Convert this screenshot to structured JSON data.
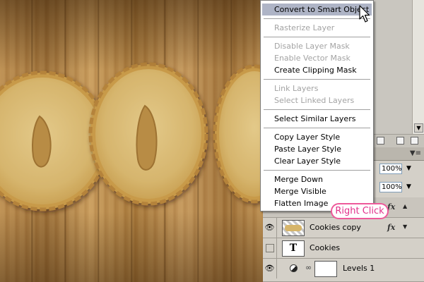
{
  "context_menu": {
    "items": [
      {
        "label": "Convert to Smart Object",
        "state": "highlighted"
      },
      {
        "label": "Rasterize Layer",
        "state": "disabled"
      },
      {
        "label": "Disable Layer Mask",
        "state": "disabled"
      },
      {
        "label": "Enable Vector Mask",
        "state": "disabled"
      },
      {
        "label": "Create Clipping Mask",
        "state": "enabled"
      },
      {
        "label": "Link Layers",
        "state": "disabled"
      },
      {
        "label": "Select Linked Layers",
        "state": "disabled"
      },
      {
        "label": "Select Similar Layers",
        "state": "enabled"
      },
      {
        "label": "Copy Layer Style",
        "state": "enabled"
      },
      {
        "label": "Paste Layer Style",
        "state": "enabled"
      },
      {
        "label": "Clear Layer Style",
        "state": "enabled"
      },
      {
        "label": "Merge Down",
        "state": "enabled"
      },
      {
        "label": "Merge Visible",
        "state": "enabled"
      },
      {
        "label": "Flatten Image",
        "state": "enabled"
      }
    ],
    "highlight_color": "#aeb4c6"
  },
  "layers_panel": {
    "opacity_value": "100%",
    "fill_value": "100%",
    "fx_label": "fx",
    "layers": [
      {
        "name": "Cookies copy",
        "visible": true,
        "has_fx": true,
        "thumb": "cookie-thumbnail"
      },
      {
        "name": "Cookies",
        "visible": false,
        "has_fx": false,
        "thumb": "text-layer-thumbnail",
        "thumb_glyph": "T"
      },
      {
        "name": "Levels 1",
        "visible": true,
        "has_fx": false,
        "thumb": "adjustment-mask-thumbnail"
      }
    ]
  },
  "annotation": {
    "label": "Right Click",
    "color": "#e2308a"
  },
  "icons": {
    "eye": "👁",
    "chain": "∞",
    "dropdown": "▼",
    "menu": "▼≡",
    "collapse": "▲"
  }
}
